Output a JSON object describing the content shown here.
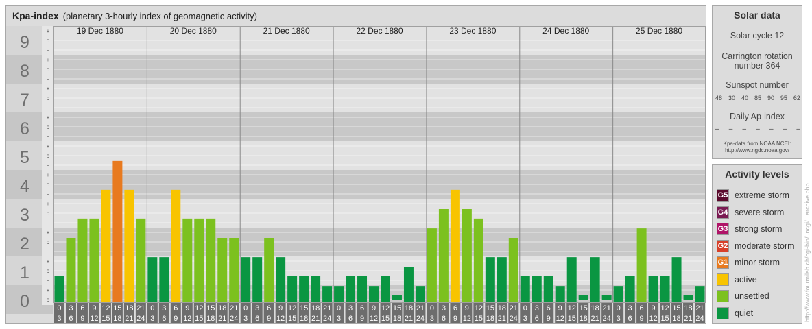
{
  "header": {
    "title": "Kpa-index",
    "subtitle": "(planetary 3-hourly index of geomagnetic activity)"
  },
  "chart_data": {
    "type": "bar",
    "title": "Kpa-index",
    "subtitle": "(planetary 3-hourly index of geomagnetic activity)",
    "ylim": [
      0,
      9
    ],
    "y_ticks": [
      "0",
      "1",
      "2",
      "3",
      "4",
      "5",
      "6",
      "7",
      "8",
      "9"
    ],
    "sub_ticks": [
      "o",
      "+",
      "−"
    ],
    "days": [
      "19 Dec 1880",
      "20 Dec 1880",
      "21 Dec 1880",
      "22 Dec 1880",
      "23 Dec 1880",
      "24 Dec 1880",
      "25 Dec 1880"
    ],
    "interval_labels": [
      [
        "0",
        "3"
      ],
      [
        "3",
        "6"
      ],
      [
        "6",
        "9"
      ],
      [
        "9",
        "12"
      ],
      [
        "12",
        "15"
      ],
      [
        "15",
        "18"
      ],
      [
        "18",
        "21"
      ],
      [
        "21",
        "24"
      ]
    ],
    "values": [
      [
        0.67,
        2.0,
        2.67,
        2.67,
        3.67,
        4.67,
        3.67,
        2.67
      ],
      [
        1.33,
        1.33,
        3.67,
        2.67,
        2.67,
        2.67,
        2.0,
        2.0
      ],
      [
        1.33,
        1.33,
        2.0,
        1.33,
        0.67,
        0.67,
        0.67,
        0.33
      ],
      [
        0.33,
        0.67,
        0.67,
        0.33,
        0.67,
        0.0,
        1.0,
        0.33
      ],
      [
        2.33,
        3.0,
        3.67,
        3.0,
        2.67,
        1.33,
        1.33,
        2.0
      ],
      [
        0.67,
        0.67,
        0.67,
        0.33,
        1.33,
        0.0,
        1.33,
        0.0
      ],
      [
        0.33,
        0.67,
        2.33,
        0.67,
        0.67,
        1.33,
        0.0,
        0.33
      ]
    ],
    "colors": {
      "quiet": "#0a9642",
      "unsettled": "#7cc11f",
      "active": "#f8c400",
      "minor_storm": "#e87a1f"
    },
    "grid": true
  },
  "solar": {
    "heading": "Solar data",
    "cycle": "Solar cycle 12",
    "carrington_line1": "Carrington rotation",
    "carrington_line2": "number 364",
    "sunspot_heading": "Sunspot number",
    "sunspot_values": [
      "48",
      "30",
      "40",
      "85",
      "90",
      "95",
      "62"
    ],
    "ap_heading": "Daily Ap-index",
    "ap_values": [
      "–",
      "–",
      "–",
      "–",
      "–",
      "–",
      "–"
    ],
    "source_line1": "Kpa-data from NOAA NCEI:",
    "source_line2": "http://www.ngdc.noaa.gov/"
  },
  "activity": {
    "heading": "Activity levels",
    "items": [
      {
        "code": "G5",
        "label": "extreme storm",
        "color": "#5a0a2c"
      },
      {
        "code": "G4",
        "label": "severe storm",
        "color": "#7a1a52"
      },
      {
        "code": "G3",
        "label": "strong storm",
        "color": "#b01468"
      },
      {
        "code": "G2",
        "label": "moderate storm",
        "color": "#d8402a"
      },
      {
        "code": "G1",
        "label": "minor storm",
        "color": "#e87a1f"
      },
      {
        "code": "",
        "label": "active",
        "color": "#f8c400"
      },
      {
        "code": "",
        "label": "unsettled",
        "color": "#7cc11f"
      },
      {
        "code": "",
        "label": "quiet",
        "color": "#0a9642"
      }
    ]
  },
  "watermark": "http://www.fourmilab.ch/cgi-bin/uncgi/...archive.php"
}
